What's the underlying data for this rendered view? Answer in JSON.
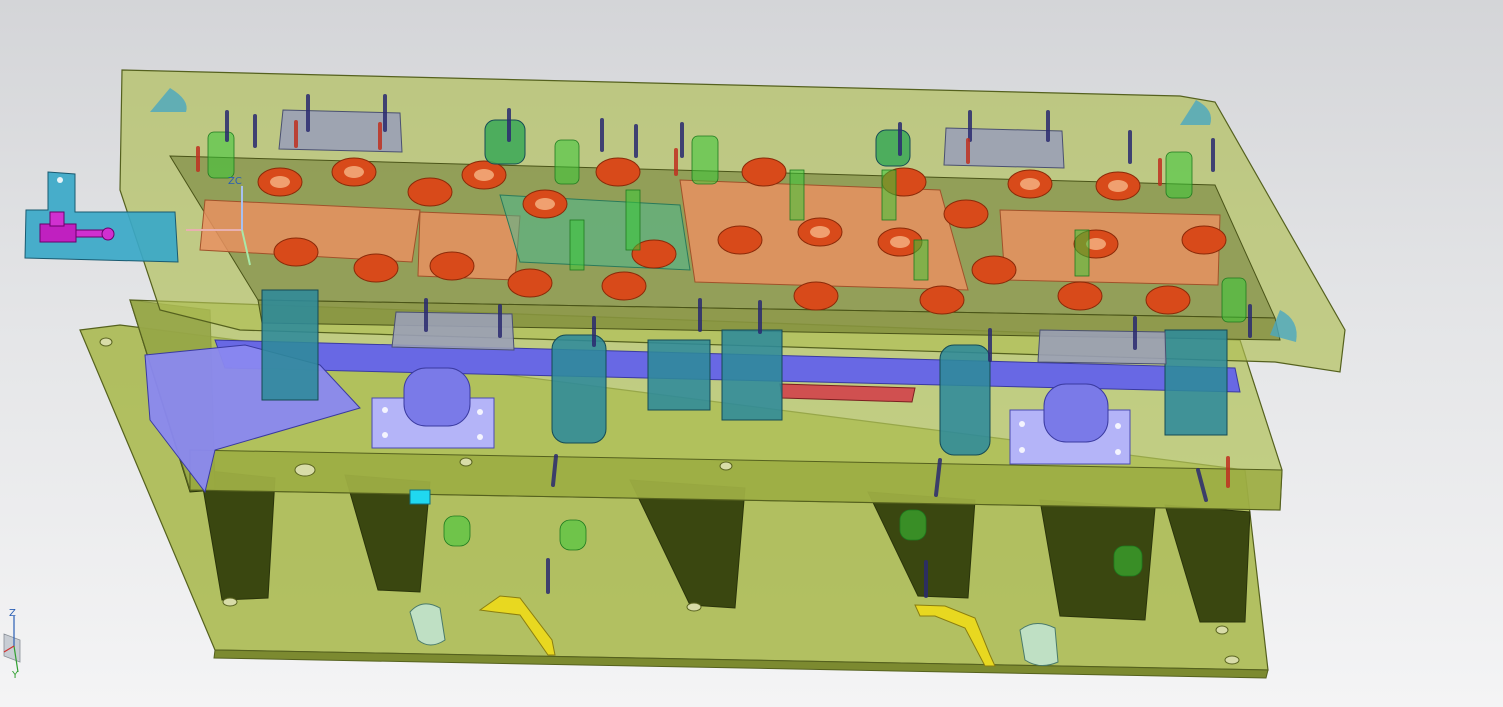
{
  "viewport": {
    "background_top": "#d4d5d8",
    "background_bottom": "#f4f4f5"
  },
  "model": {
    "description_colors": {
      "plate_fill": "#a8b84a",
      "plate_edge": "#5a6620",
      "pillar_fill": "#3c4a10",
      "orange_insert": "#e88a50",
      "red_bushing": "#d84a1a",
      "blue_part": "#6a6ae8",
      "teal_part": "#2e8a9a",
      "green_pin": "#3ec43e",
      "yellow_highlight": "#e8d820",
      "cyan_clamp": "#3aa8c8",
      "magenta_part": "#c020c0"
    }
  },
  "triad": {
    "z_label": "Z",
    "y_label": "Y",
    "x_color": "#d03030",
    "y_color": "#30a030",
    "z_color": "#2a5fb5"
  },
  "csys_marker": {
    "label": "ZC"
  }
}
